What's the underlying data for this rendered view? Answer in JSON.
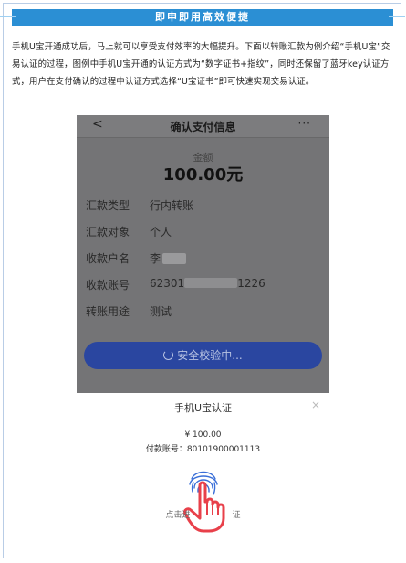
{
  "header": {
    "title": "即申即用高效便捷"
  },
  "intro": "手机U宝开通成功后，马上就可以享受支付效率的大幅提升。下面以转账汇款为例介绍“手机U宝”交易认证的过程，图例中手机U宝开通的认证方式为“数字证书+指纹”，同时还保留了蓝牙key认证方式，用户在支付确认的过程中认证方式选择“U宝证书”即可快速实现交易认证。",
  "phone": {
    "nav": {
      "back": "<",
      "title": "确认支付信息",
      "more": "···"
    },
    "amount_label": "金额",
    "amount_value": "100.00元",
    "rows": [
      {
        "label": "汇款类型",
        "value": "行内转账"
      },
      {
        "label": "汇款对象",
        "value": "个人"
      },
      {
        "label": "收款户名",
        "value": "李"
      },
      {
        "label": "收款账号",
        "value_prefix": "62301",
        "value_suffix": "1226"
      },
      {
        "label": "转账用途",
        "value": "测试"
      }
    ],
    "verify_button": "安全校验中...",
    "sheet": {
      "title": "手机U宝认证",
      "close": "×",
      "amount": "¥ 100.00",
      "account": "付款账号：80101900001113",
      "hint_left": "点击进",
      "hint_right": "证"
    }
  },
  "colors": {
    "accent": "#2b8fd4",
    "button": "#2a46a0",
    "hand": "#e8404a"
  }
}
